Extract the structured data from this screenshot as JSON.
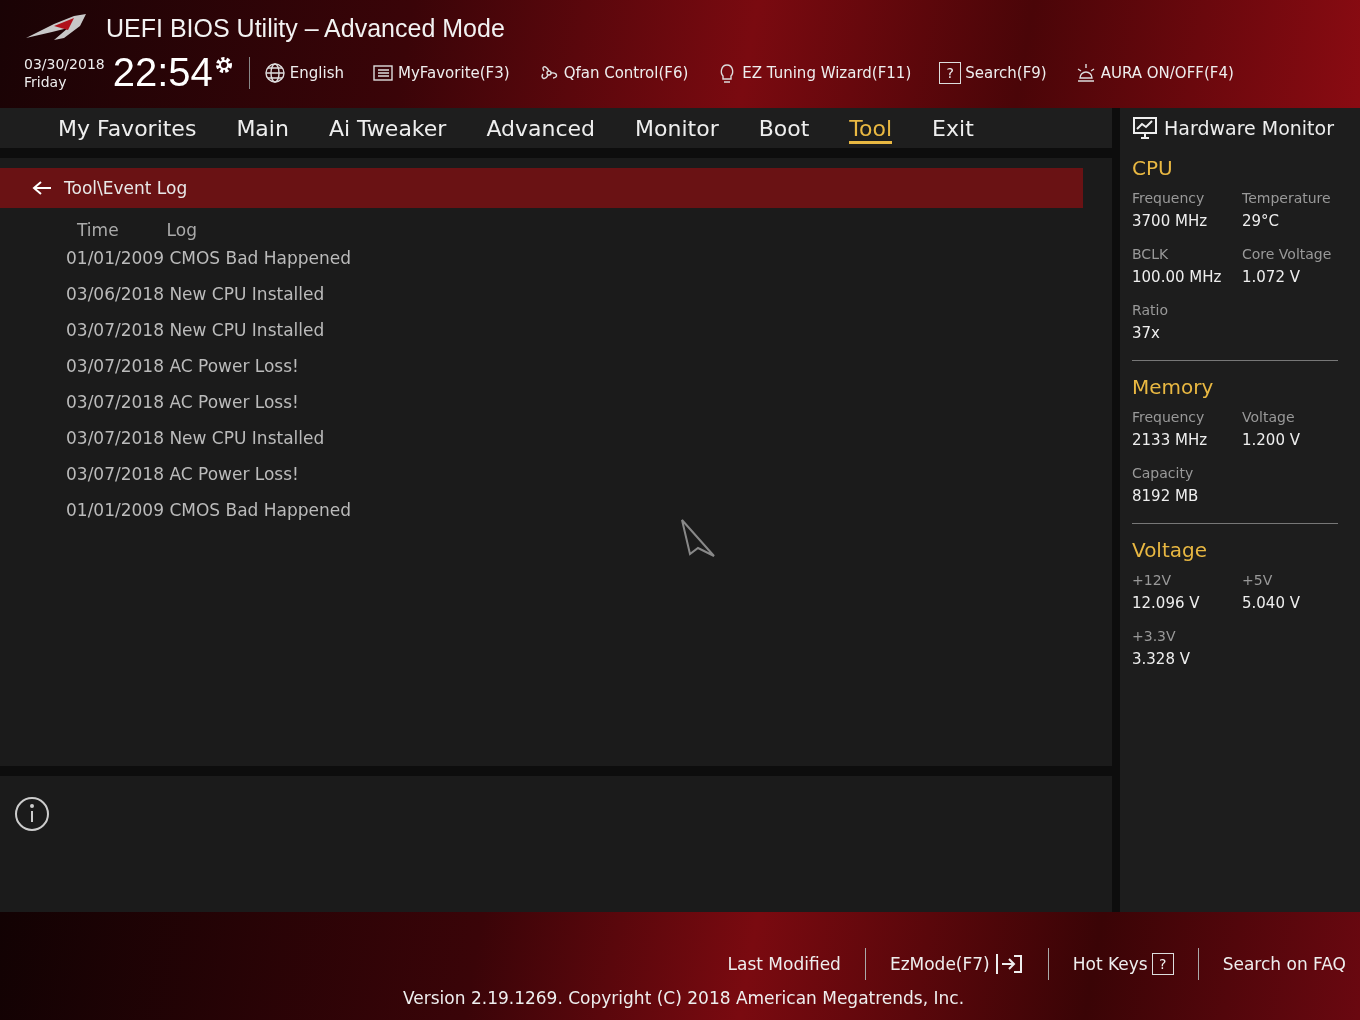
{
  "header": {
    "title": "UEFI BIOS Utility – Advanced Mode",
    "date": "03/30/2018",
    "day": "Friday",
    "time": "22:54",
    "tools": [
      {
        "kind": "language",
        "label": "English"
      },
      {
        "kind": "favorite",
        "label": "MyFavorite(F3)"
      },
      {
        "kind": "fan",
        "label": "Qfan Control(F6)"
      },
      {
        "kind": "wizard",
        "label": "EZ Tuning Wizard(F11)"
      },
      {
        "kind": "search",
        "label": "Search(F9)",
        "glyph": "?"
      },
      {
        "kind": "aura",
        "label": "AURA ON/OFF(F4)"
      }
    ]
  },
  "tabs": [
    {
      "label": "My Favorites",
      "selected": false
    },
    {
      "label": "Main",
      "selected": false
    },
    {
      "label": "Ai Tweaker",
      "selected": false
    },
    {
      "label": "Advanced",
      "selected": false
    },
    {
      "label": "Monitor",
      "selected": false
    },
    {
      "label": "Boot",
      "selected": false
    },
    {
      "label": "Tool",
      "selected": true
    },
    {
      "label": "Exit",
      "selected": false
    }
  ],
  "breadcrumb": "Tool\\Event Log",
  "log": {
    "columns": [
      "Time",
      "Log"
    ],
    "rows": [
      "01/01/2009 CMOS Bad Happened",
      "03/06/2018 New CPU Installed",
      "03/07/2018 New CPU Installed",
      "03/07/2018 AC Power Loss!",
      "03/07/2018 AC Power Loss!",
      "03/07/2018 New CPU Installed",
      "03/07/2018 AC Power Loss!",
      "01/01/2009 CMOS Bad Happened"
    ]
  },
  "hardware_monitor": {
    "title": "Hardware Monitor",
    "sections": [
      {
        "title": "CPU",
        "items": [
          {
            "label": "Frequency",
            "value": "3700 MHz"
          },
          {
            "label": "Temperature",
            "value": "29°C"
          },
          {
            "label": "BCLK",
            "value": "100.00 MHz"
          },
          {
            "label": "Core Voltage",
            "value": "1.072 V"
          },
          {
            "label": "Ratio",
            "value": "37x"
          }
        ]
      },
      {
        "title": "Memory",
        "items": [
          {
            "label": "Frequency",
            "value": "2133 MHz"
          },
          {
            "label": "Voltage",
            "value": "1.200 V"
          },
          {
            "label": "Capacity",
            "value": "8192 MB"
          }
        ]
      },
      {
        "title": "Voltage",
        "items": [
          {
            "label": "+12V",
            "value": "12.096 V"
          },
          {
            "label": "+5V",
            "value": "5.040 V"
          },
          {
            "label": "+3.3V",
            "value": "3.328 V"
          }
        ]
      }
    ]
  },
  "footer": {
    "links": [
      {
        "kind": "plain",
        "label": "Last Modified"
      },
      {
        "kind": "exit",
        "label": "EzMode(F7)"
      },
      {
        "kind": "help",
        "label": "Hot Keys",
        "glyph": "?"
      },
      {
        "kind": "plain",
        "label": "Search on FAQ"
      }
    ],
    "version": "Version 2.19.1269. Copyright (C) 2018 American Megatrends, Inc."
  }
}
